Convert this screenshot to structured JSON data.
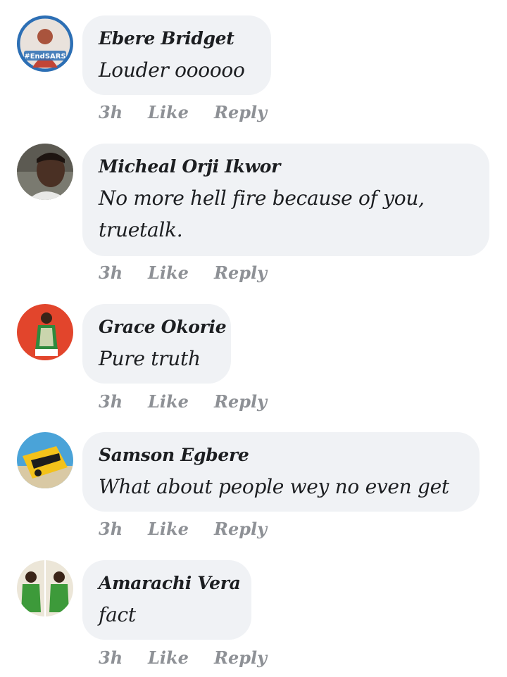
{
  "comments": [
    {
      "author": "Ebere Bridget",
      "text": "Louder oooooo",
      "time": "3h",
      "like": "Like",
      "reply": "Reply",
      "avatar_badge": "#EndSARS",
      "avatar_colors": [
        "#2c6fb5",
        "#e9e2dc"
      ]
    },
    {
      "author": "Micheal Orji Ikwor",
      "text": "No more hell fire because of you, truetalk.",
      "time": "3h",
      "like": "Like",
      "reply": "Reply",
      "avatar_colors": [
        "#3b2a22",
        "#7a7a70"
      ]
    },
    {
      "author": "Grace Okorie",
      "text": "Pure truth",
      "time": "3h",
      "like": "Like",
      "reply": "Reply",
      "avatar_colors": [
        "#e2452c",
        "#2f8a3e"
      ]
    },
    {
      "author": "Samson Egbere",
      "text": "What about people wey no even get",
      "time": "3h",
      "like": "Like",
      "reply": "Reply",
      "avatar_colors": [
        "#f3c21a",
        "#4aa3d8"
      ]
    },
    {
      "author": "Amarachi Vera",
      "text": "fact",
      "time": "3h",
      "like": "Like",
      "reply": "Reply",
      "avatar_colors": [
        "#3d9a3a",
        "#ece6d8"
      ]
    }
  ]
}
